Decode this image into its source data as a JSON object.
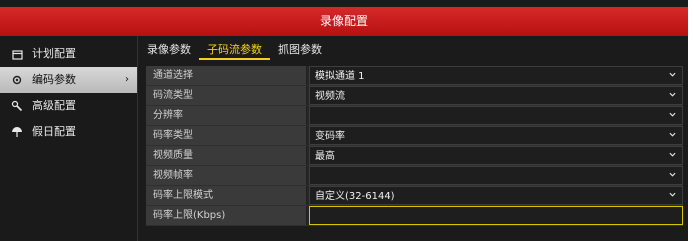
{
  "window": {
    "title": "录像配置"
  },
  "sidebar": {
    "items": [
      {
        "label": "计划配置",
        "icon": "calendar-icon",
        "active": false
      },
      {
        "label": "编码参数",
        "icon": "gear-icon",
        "active": true
      },
      {
        "label": "高级配置",
        "icon": "wrench-icon",
        "active": false
      },
      {
        "label": "假日配置",
        "icon": "umbrella-icon",
        "active": false
      }
    ],
    "active_arrow": "›"
  },
  "tabs": [
    {
      "label": "录像参数",
      "active": false
    },
    {
      "label": "子码流参数",
      "active": true
    },
    {
      "label": "抓图参数",
      "active": false
    }
  ],
  "form": {
    "rows": [
      {
        "label": "通道选择",
        "value": "模拟通道 1",
        "dropdown": true
      },
      {
        "label": "码流类型",
        "value": "视频流",
        "dropdown": true
      },
      {
        "label": "分辨率",
        "value": "",
        "dropdown": true
      },
      {
        "label": "码率类型",
        "value": "变码率",
        "dropdown": true
      },
      {
        "label": "视频质量",
        "value": "最高",
        "dropdown": true
      },
      {
        "label": "视频帧率",
        "value": "",
        "dropdown": true
      },
      {
        "label": "码率上限模式",
        "value": "自定义(32-6144)",
        "dropdown": true
      },
      {
        "label": "码率上限(Kbps)",
        "value": "",
        "dropdown": false
      }
    ]
  },
  "colors": {
    "titlebar": "#c81c1c",
    "tab_active": "#f3d21b",
    "background": "#1b1b1b"
  }
}
